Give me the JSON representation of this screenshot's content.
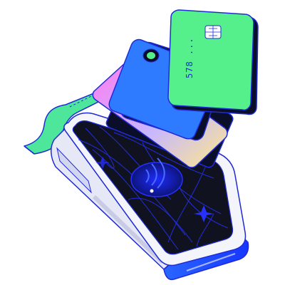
{
  "illustration": {
    "subject": "payment-terminal-with-cards",
    "colors": {
      "outline": "#1f2bd6",
      "terminal_body": "#f4f5fb",
      "terminal_shadow": "#c9cbe6",
      "screen": "#10131f",
      "screen_lines": "#2630ff",
      "receipt": "#4ee69a",
      "card_green": "#55f08c",
      "card_blue": "#2f7bff",
      "card_dark": "#0b0e28",
      "card_gradient_start": "#ff7af2",
      "card_gradient_end": "#ffe98a",
      "accent_blue": "#1736ff",
      "chip": "#ffffff"
    },
    "card_number_fragment": "578 ..."
  }
}
